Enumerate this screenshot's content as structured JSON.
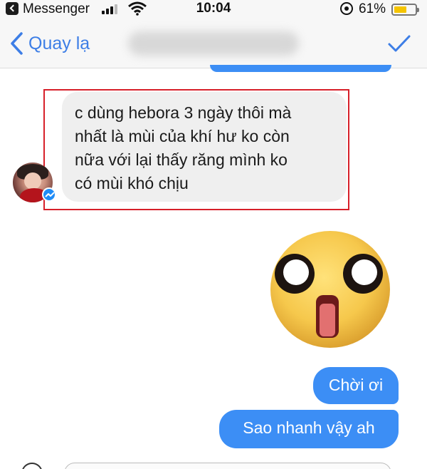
{
  "status_bar": {
    "app_name": "Messenger",
    "time": "10:04",
    "battery_percent_text": "61%",
    "battery_level": 0.61,
    "battery_color": "#f5c400"
  },
  "nav": {
    "back_label": "Quay lạ",
    "back_icon": "chevron-left-icon",
    "done_icon": "checkmark-icon",
    "accent": "#3d7ee6"
  },
  "messages": {
    "incoming_text": "c dùng hebora 3 ngày thôi mà nhất là mùi của khí hư ko còn nữa với lại thấy răng mình ko có mùi khó chịu",
    "incoming_lines": [
      "c dùng hebora 3 ngày thôi mà",
      "nhất là mùi của khí hư ko còn",
      "nữa với lại thấy răng mình ko",
      "có mùi khó chịu"
    ],
    "sticker": "shocked-face-sticker",
    "outgoing": [
      "Chời ơi",
      "Sao nhanh vậy ah"
    ],
    "outgoing_color": "#3c8ef5",
    "highlight_color": "#d7202a"
  }
}
